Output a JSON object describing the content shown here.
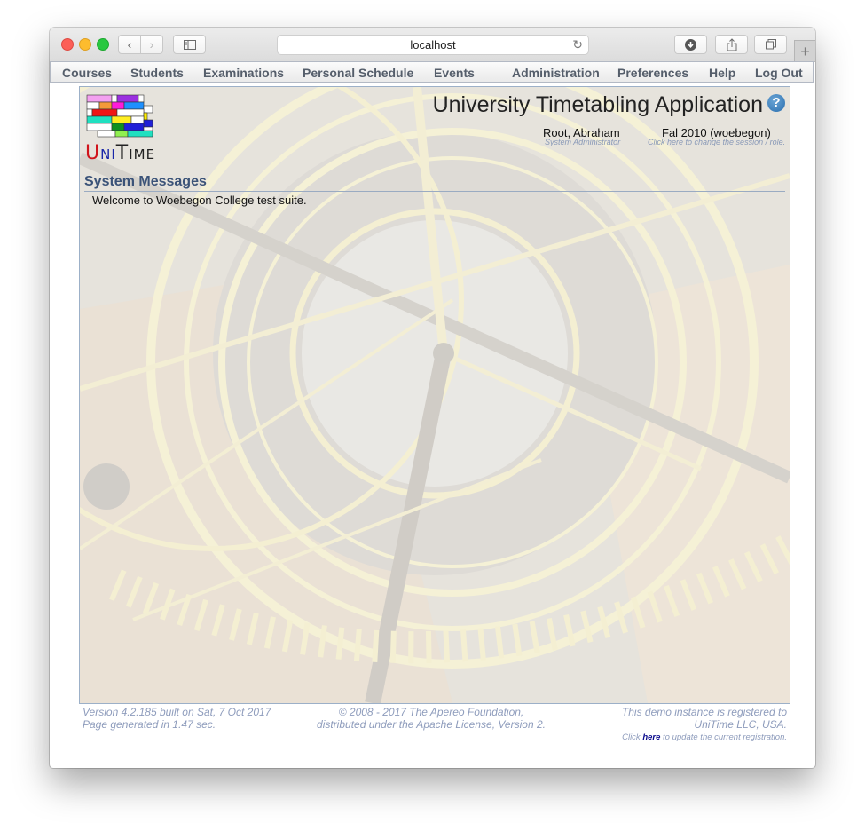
{
  "browser": {
    "url": "localhost",
    "back_icon": "chevron-left-icon",
    "forward_icon": "chevron-right-icon",
    "sidebar_icon": "sidebar-icon",
    "reload_icon": "reload-icon",
    "download_icon": "download-icon",
    "share_icon": "share-icon",
    "tabs_icon": "tabs-icon",
    "new_tab_icon": "plus-icon"
  },
  "menu": {
    "items": [
      {
        "label": "Courses"
      },
      {
        "label": "Students"
      },
      {
        "label": "Examinations"
      },
      {
        "label": "Personal Schedule"
      },
      {
        "label": "Events"
      },
      {
        "label": "Administration"
      },
      {
        "label": "Preferences"
      },
      {
        "label": "Help"
      },
      {
        "label": "Log Out"
      }
    ]
  },
  "header": {
    "logo_text": {
      "u": "U",
      "ni": "NI",
      "t": "T",
      "ime": "IME"
    },
    "app_title": "University Timetabling Application",
    "help_icon": "?",
    "user_name": "Root, Abraham",
    "user_role": "System Administrator",
    "session": "Fal 2010 (woebegon)",
    "session_hint": "Click here to change the session / role."
  },
  "content": {
    "section_title": "System Messages",
    "message": "Welcome to Woebegon College test suite."
  },
  "footer": {
    "version": "Version 4.2.185 built on Sat, 7 Oct 2017",
    "generated": "Page generated in 1.47 sec.",
    "copyright": "© 2008 - 2017 The Apereo Foundation,",
    "license": "distributed under the Apache License, Version 2.",
    "registered_line1": "This demo instance is registered to",
    "registered_line2": "UniTime LLC, USA.",
    "reg_prefix": "Click ",
    "reg_link": "here",
    "reg_suffix": " to update the current registration."
  },
  "colors": {
    "menu_text": "#555e6b",
    "section_title": "#3b5378",
    "footer_text": "#8e9cbc",
    "link": "#0a0a8c"
  }
}
